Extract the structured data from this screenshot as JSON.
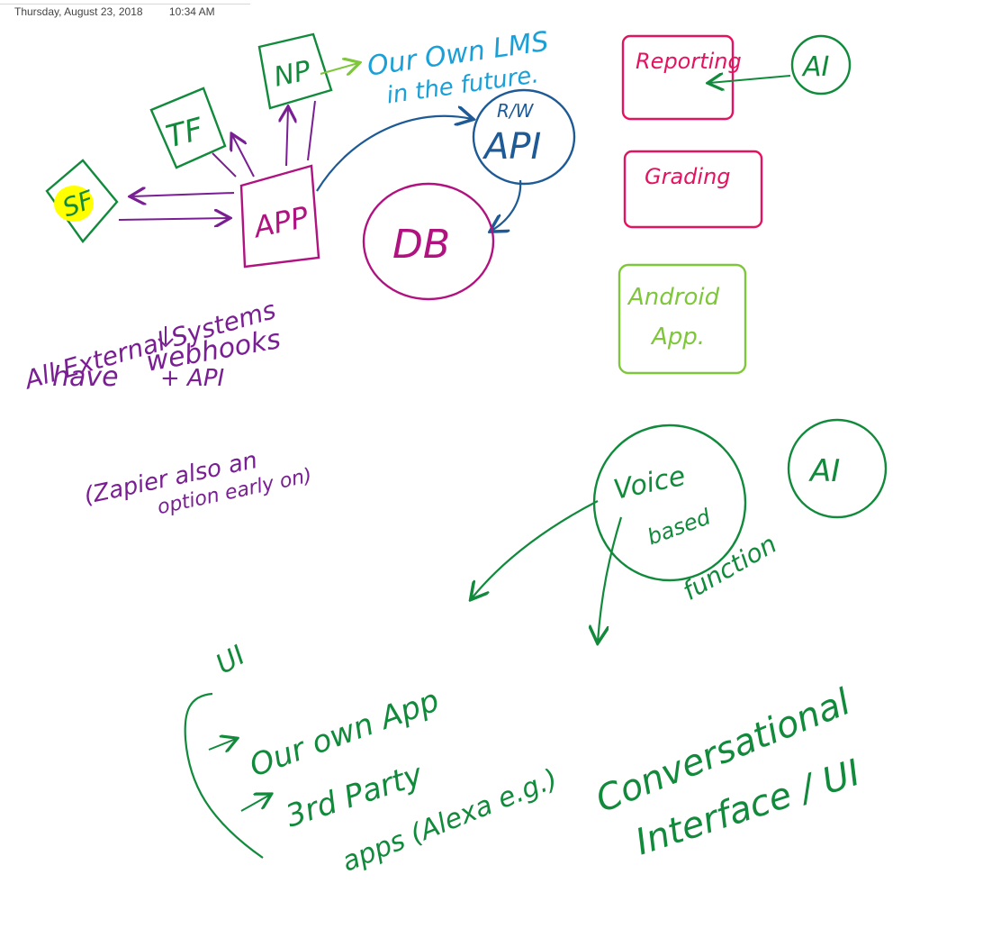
{
  "header": {
    "date": "Thursday, August 23, 2018",
    "time": "10:34 AM"
  },
  "colors": {
    "green": "#118a3c",
    "purple": "#7a1f93",
    "magenta": "#b0127f",
    "blue": "#1d5a96",
    "cyan": "#1aa0d8",
    "pink": "#e31362",
    "lime": "#7ec63a",
    "highlight": "#ffff00"
  },
  "nodes": {
    "sf": "SF",
    "tf": "TF",
    "np": "NP",
    "app": "APP",
    "rw": "R/W",
    "api": "API",
    "db": "DB",
    "reporting": "Reporting",
    "ai_top": "AI",
    "grading": "Grading",
    "android_line1": "Android",
    "android_line2": "App.",
    "voice_line1": "Voice",
    "voice_line2": "based",
    "voice_line3": "function",
    "ai_right": "AI"
  },
  "notes": {
    "lms_line1": "Our Own LMS",
    "lms_line2": "in the future.",
    "external_line1": "All External Systems",
    "external_line2": "have",
    "external_line3": "webhooks",
    "external_line4": "+ API",
    "zapier_line1": "(Zapier also an",
    "zapier_line2": "option early on)",
    "ui_label": "UI",
    "own_app": "Our own App",
    "third_party_line1": "3rd Party",
    "third_party_line2": "apps (Alexa e.g.)",
    "conv_line1": "Conversational",
    "conv_line2": "Interface / UI"
  }
}
